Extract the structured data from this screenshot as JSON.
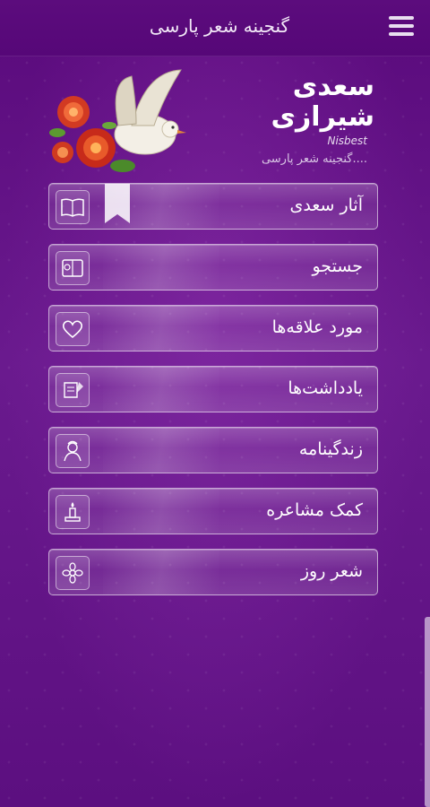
{
  "topbar": {
    "title": "گنجینه شعر پارسی"
  },
  "header": {
    "poet_line1": "سعدی",
    "poet_line2": "شیرازی",
    "brand_mark": "Nisbest",
    "subtitle": "....گنجینه شعر پارسی"
  },
  "menu": [
    {
      "label": "آثار سعدی",
      "icon": "book-icon"
    },
    {
      "label": "جستجو",
      "icon": "search-book-icon"
    },
    {
      "label": "مورد علاقه‌ها",
      "icon": "heart-icon"
    },
    {
      "label": "یادداشت‌ها",
      "icon": "scroll-quill-icon"
    },
    {
      "label": "زندگینامه",
      "icon": "poet-portrait-icon"
    },
    {
      "label": "کمک مشاعره",
      "icon": "candle-icon"
    },
    {
      "label": "شعر روز",
      "icon": "flower-icon"
    }
  ],
  "colors": {
    "background": "#6a1a8e",
    "topbar": "#5a0a7c",
    "accent": "#ffffff"
  }
}
